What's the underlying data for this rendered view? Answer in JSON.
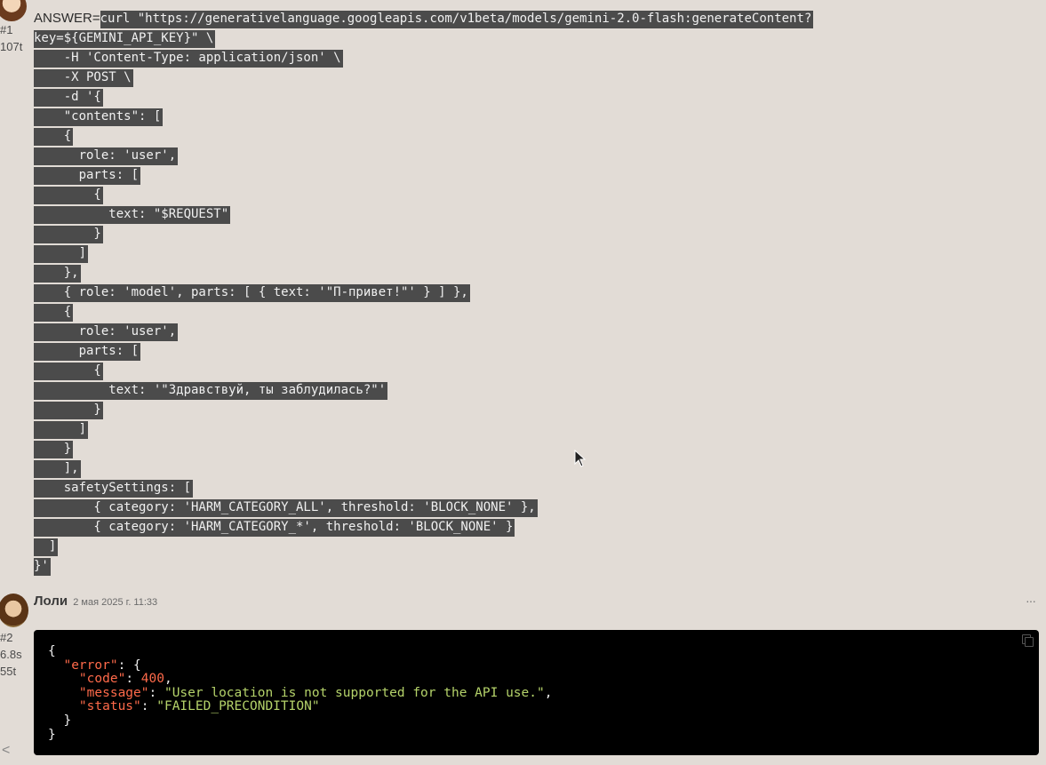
{
  "message1": {
    "number": "#1",
    "tokens": "107t",
    "prefix": "ANSWER=",
    "lines": [
      "curl \"https://generativelanguage.googleapis.com/v1beta/models/gemini-2.0-flash:generateContent?",
      "key=${GEMINI_API_KEY}\" \\",
      "    -H 'Content-Type: application/json' \\",
      "    -X POST \\",
      "    -d '{",
      "    \"contents\": [",
      "    {",
      "      role: 'user',",
      "      parts: [",
      "        {",
      "          text: \"$REQUEST\"",
      "        }",
      "      ]",
      "    },",
      "    { role: 'model', parts: [ { text: '\"П-привет!\"' } ] },",
      "    {",
      "      role: 'user',",
      "      parts: [",
      "        {",
      "          text: '\"Здравствуй, ты заблудилась?\"'",
      "        }",
      "      ]",
      "    }",
      "    ],",
      "    safetySettings: [",
      "        { category: 'HARM_CATEGORY_ALL', threshold: 'BLOCK_NONE' },",
      "        { category: 'HARM_CATEGORY_*', threshold: 'BLOCK_NONE' }",
      "  ]",
      "}'"
    ]
  },
  "message2": {
    "author": "Лоли",
    "timestamp": "2 мая 2025 г. 11:33",
    "number": "#2",
    "time": "6.8s",
    "tokens": "55t",
    "more_icon": "···",
    "response": {
      "open": "{",
      "error_key": "\"error\"",
      "code_key": "\"code\"",
      "code_value": "400",
      "message_key": "\"message\"",
      "message_value": "\"User location is not supported for the API use.\"",
      "status_key": "\"status\"",
      "status_value": "\"FAILED_PRECONDITION\"",
      "inner_close": "}",
      "close": "}"
    }
  },
  "nav": {
    "scroll_left_icon": "<"
  },
  "colors": {
    "background": "#e2dcd6",
    "selection": "#4b4b4b",
    "terminal_bg": "#000000",
    "json_key": "#ff6a4a",
    "json_string": "#b5d36a"
  }
}
